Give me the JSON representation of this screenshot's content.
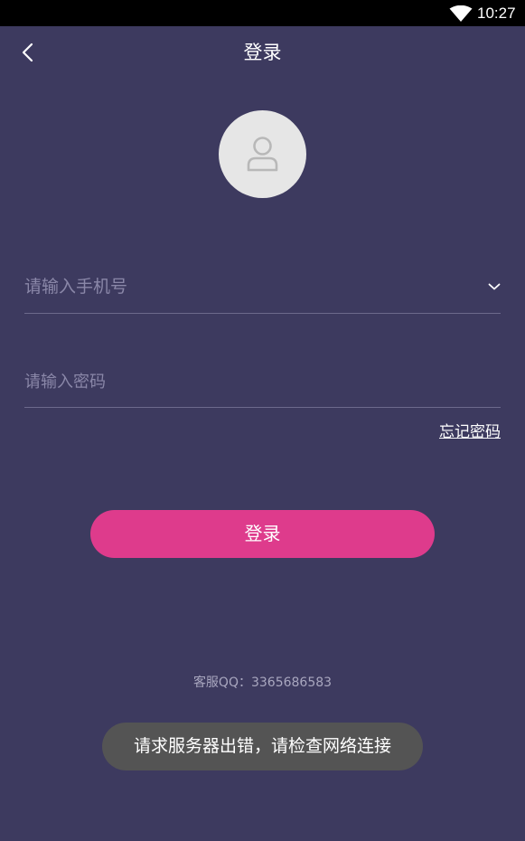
{
  "status_bar": {
    "time": "10:27",
    "wifi_icon": "wifi-icon"
  },
  "header": {
    "title": "登录",
    "back_icon": "chevron-left-icon"
  },
  "avatar": {
    "icon": "user-icon"
  },
  "form": {
    "phone_placeholder": "请输入手机号",
    "phone_value": "",
    "phone_dropdown_icon": "chevron-down-icon",
    "password_placeholder": "请输入密码",
    "password_value": "",
    "forgot_password": "忘记密码"
  },
  "login_button": "登录",
  "service": {
    "qq": "客服QQ：3365686583"
  },
  "toast": {
    "message": "请求服务器出错，请检查网络连接"
  },
  "colors": {
    "background": "#3d3a5f",
    "accent": "#de3b8c",
    "toast_background": "#545454"
  }
}
